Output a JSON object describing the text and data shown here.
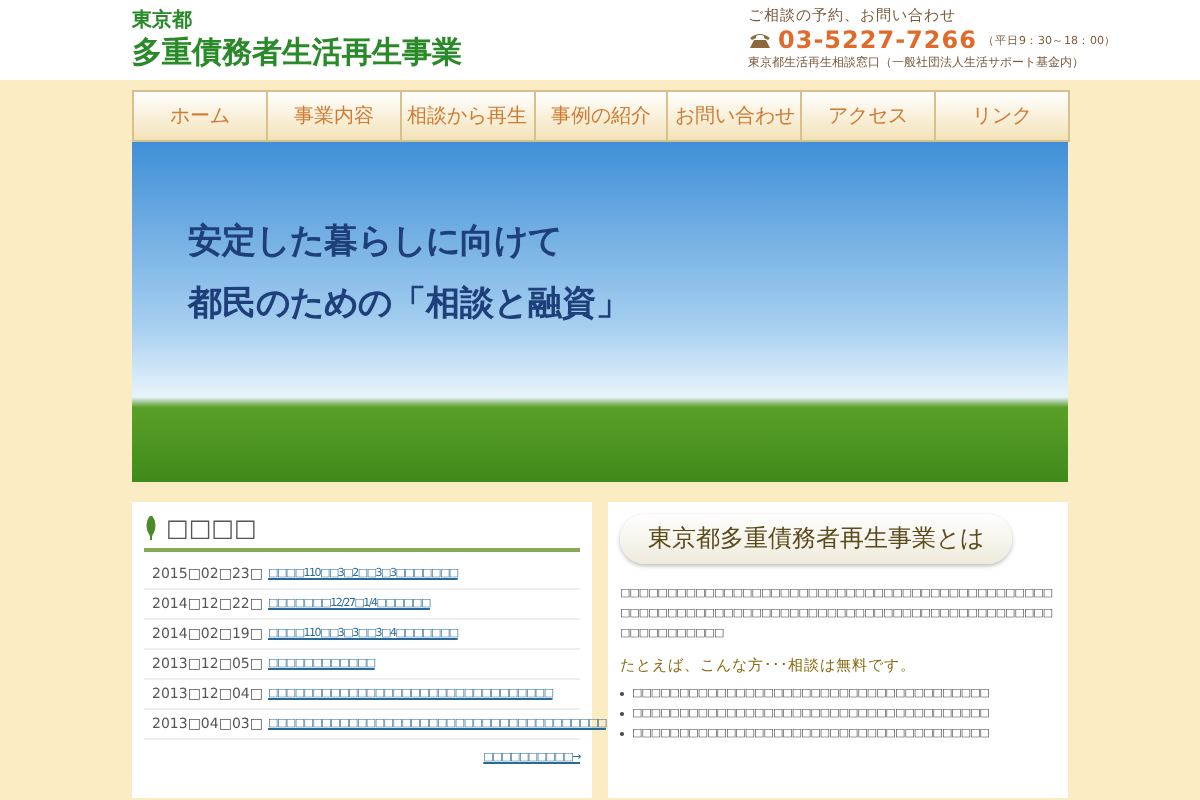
{
  "header": {
    "pref": "東京都",
    "title": "多重債務者生活再生事業",
    "contact_label": "ご相談の予約、お問い合わせ",
    "phone": "03-5227-7266",
    "hours": "（平日9：30～18：00）",
    "office": "東京都生活再生相談窓口（一般社団法人生活サポート基金内）"
  },
  "nav": [
    {
      "label": "ホーム",
      "selected": false
    },
    {
      "label": "事業内容",
      "selected": false
    },
    {
      "label": "相談から再生",
      "selected": false
    },
    {
      "label": "事例の紹介",
      "selected": false
    },
    {
      "label": "お問い合わせ",
      "selected": false
    },
    {
      "label": "アクセス",
      "selected": false
    },
    {
      "label": "リンク",
      "selected": false
    }
  ],
  "hero": {
    "lines": [
      "安定した暮らしに向けて",
      "都民のための「相談と融資」"
    ]
  },
  "news": {
    "title": "□□□□",
    "items": [
      {
        "date": "2015□02□23□",
        "text": "□□□□110□□3□2□□3□3□□□□□□□"
      },
      {
        "date": "2014□12□22□",
        "text": "□□□□□□□12/27□1/4□□□□□□"
      },
      {
        "date": "2014□02□19□",
        "text": "□□□□110□□3□3□□3□4□□□□□□□"
      },
      {
        "date": "2013□12□05□",
        "text": "□□□□□□□□□□□□"
      },
      {
        "date": "2013□12□04□",
        "text": "□□□□□□□□□□□□□□□□□□□□□□□□□□□□□□□□"
      },
      {
        "date": "2013□04□03□",
        "text": "□□□□□□□□□□□□□□□□□□□□□□□□□□□□□□□□□□□□□□"
      }
    ],
    "more": "□□□□□□□□□□→"
  },
  "about": {
    "title": "東京都多重債務者再生事業とは",
    "body": "□□□□□□□□□□□□□□□□□□□□□□□□□□□□□□□□□□□□□□□□□□□□□□□□□□□□□□□□□□□□□□□□□□□□□□□□□□□□□□□□□□□□□□□□□□□□□□□□□□□□□□□",
    "lead": "たとえば、こんな方･･･相談は無料です。",
    "bullets": [
      "□□□□□□□□□□□□□□□□□□□□□□□□□□□□□□□□□□□□□□",
      "□□□□□□□□□□□□□□□□□□□□□□□□□□□□□□□□□□□□□□",
      "□□□□□□□□□□□□□□□□□□□□□□□□□□□□□□□□□□□□□□"
    ]
  }
}
